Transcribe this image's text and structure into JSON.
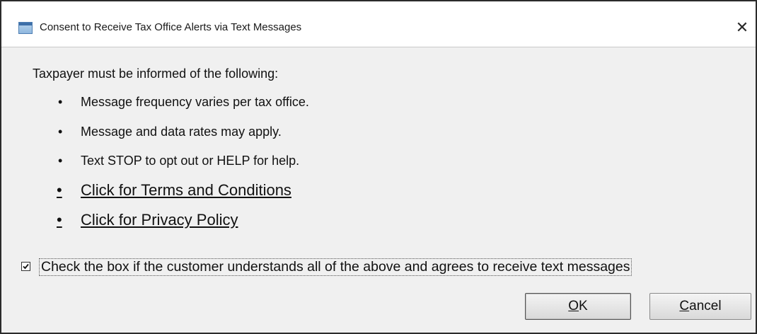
{
  "window": {
    "title": "Consent to Receive Tax Office Alerts via Text Messages",
    "close_glyph": "✕"
  },
  "content": {
    "intro": "Taxpayer must be informed of the following:",
    "bullet_glyph": "•",
    "bullets": [
      "Message frequency varies per tax office.",
      "Message and data rates may apply.",
      "Text STOP to opt out or HELP for help."
    ],
    "links": [
      "Click for Terms and Conditions",
      "Click for Privacy Policy"
    ]
  },
  "consent": {
    "checked": true,
    "label": "Check the box if the customer understands all of the above and agrees to receive text messages"
  },
  "buttons": {
    "ok_mnemonic": "O",
    "ok_rest": "K",
    "cancel_mnemonic": "C",
    "cancel_rest": "ancel"
  },
  "icons": {
    "app": "window-app-icon",
    "close": "close-icon",
    "check": "checkmark-icon"
  }
}
